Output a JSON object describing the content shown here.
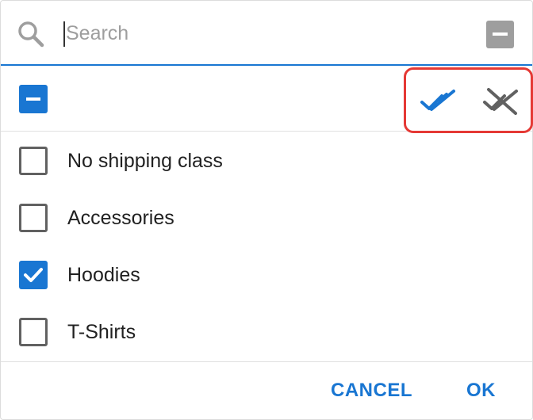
{
  "search": {
    "placeholder": "Search",
    "value": ""
  },
  "icons": {
    "search": "search-icon",
    "clear": "minus-square-icon",
    "master_checkbox": "indeterminate-checkbox-icon",
    "select_all": "double-check-icon",
    "deselect_all": "remove-all-checks-icon"
  },
  "options": [
    {
      "label": "No shipping class",
      "checked": false
    },
    {
      "label": "Accessories",
      "checked": false
    },
    {
      "label": "Hoodies",
      "checked": true
    },
    {
      "label": "T-Shirts",
      "checked": false
    }
  ],
  "footer": {
    "cancel_label": "CANCEL",
    "ok_label": "OK"
  },
  "colors": {
    "accent": "#1976d2",
    "highlight": "#e53935",
    "icon_grey": "#9e9e9e"
  }
}
